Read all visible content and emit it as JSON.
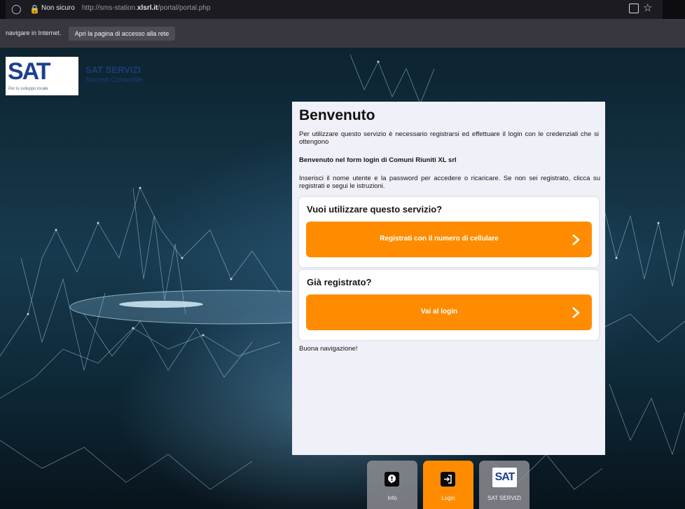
{
  "browser": {
    "security_label": "Non sicuro",
    "url_prefix": "http://sms-station.",
    "url_domain": "xlsrl.it",
    "url_path": "/portal/portal.php",
    "icons": [
      "shield-icon",
      "lock-icon",
      "tab-icon",
      "star-icon"
    ]
  },
  "notification": {
    "message": "navigare in Internet.",
    "button_label": "Apri la pagina di accesso alla rete"
  },
  "logo": {
    "text": "SAT",
    "tagline": "Per lo sviluppo locale",
    "brand": "SAT SERVIZI",
    "brand_sub": "Società Consortile"
  },
  "panel": {
    "title": "Benvenuto",
    "intro": "Per utilizzare questo servizio è necessario registrarsi ed effettuare il login con le credenziali che si ottengono",
    "form_title": "Benvenuto nel form login di Comuni Riuniti XL srl",
    "instructions": "Inserisci il nome utente e la password per accedere o ricaricare. Se non sei registrato, clicca su registrati e segui le istruzioni.",
    "register_card": {
      "heading": "Vuoi utilizzare questo servizio?",
      "button": "Registrati con il numero di cellulare"
    },
    "login_card": {
      "heading": "Già registrato?",
      "button": "Vai al login"
    },
    "closing": "Buona navigazione!"
  },
  "tabs": [
    {
      "label": "Info",
      "icon": "info-icon"
    },
    {
      "label": "Login",
      "icon": "login-icon"
    },
    {
      "label": "SAT SERVIZI",
      "icon": "sat-logo-icon"
    }
  ],
  "colors": {
    "accent": "#ff8c00",
    "panel": "#f0f0f8",
    "brand_blue": "#1c3f8f"
  }
}
